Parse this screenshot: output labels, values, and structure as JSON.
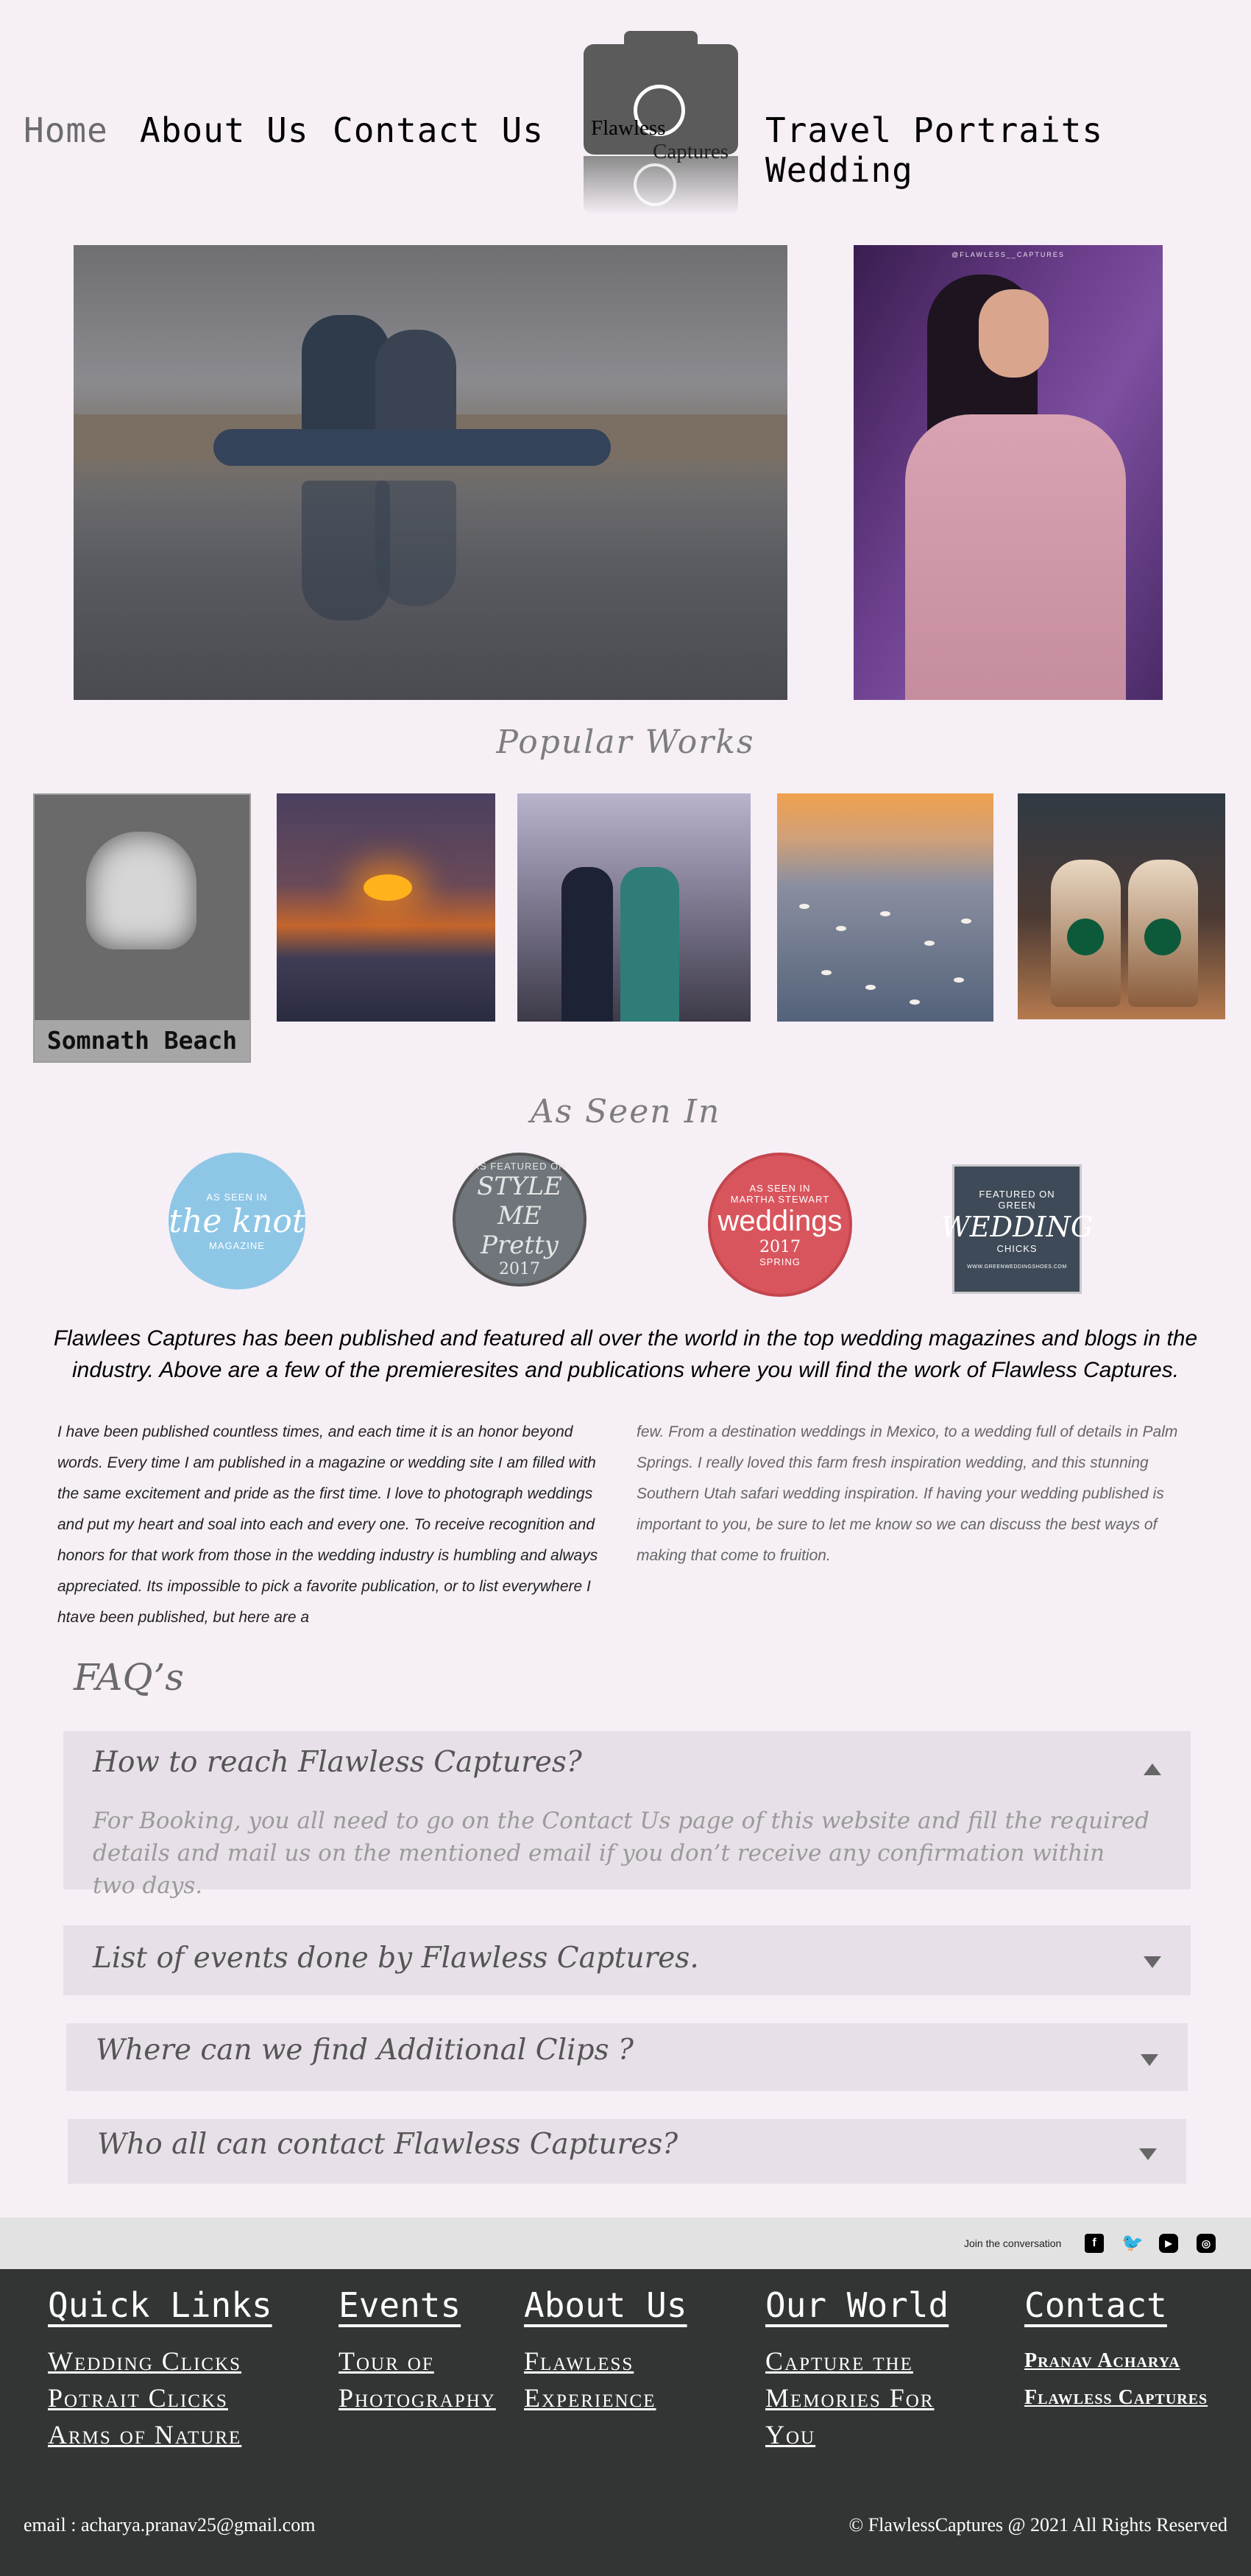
{
  "nav": {
    "home": "Home",
    "about": "About Us",
    "contact": "Contact Us",
    "right_links": "Travel Portraits Wedding",
    "logo_line1": "Flawless",
    "logo_line2": "Captures"
  },
  "hero": {
    "right_tag": "@FLAWLESS__CAPTURES"
  },
  "popular": {
    "title": "Popular Works",
    "items": [
      {
        "caption": "Somnath Beach",
        "icon": "cave-photo"
      },
      {
        "icon": "sunset-photo"
      },
      {
        "icon": "wedding-photo"
      },
      {
        "icon": "birds-photo"
      },
      {
        "icon": "coffee-photo"
      }
    ]
  },
  "seen": {
    "title": "As Seen In",
    "badges": [
      {
        "top": "AS SEEN IN",
        "main": "the knot",
        "bottom": "MAGAZINE",
        "color": "#8ec6e6"
      },
      {
        "top": "AS FEATURED ON",
        "main": "STYLE ME Pretty",
        "bottom": "2017",
        "color": "#6f757b"
      },
      {
        "top": "AS SEEN IN",
        "sub": "MARTHA STEWART",
        "main": "weddings",
        "bottom": "2017",
        "tail": "SPRING",
        "color": "#d9555d"
      },
      {
        "top": "FEATURED ON",
        "main": "WEDDING",
        "sub": "GREEN",
        "bottom": "CHICKS",
        "foot": "WWW.GREENWEDDINGSHOES.COM",
        "color": "#3e4a57"
      }
    ],
    "intro": "Flawlees Captures has been published and featured all over the world in the top wedding magazines and blogs in the industry. Above are a few of the premieresites and publications where you will find the work of Flawless Captures.",
    "col1": "I have been published countless times, and each time it is an honor beyond  words. Every time I am published in a magazine or wedding site I am filled with the same excitement and pride as the first time. I love to photograph weddings and put my heart and soal into each and every one. To receive recognition and honors for that work from those in the wedding industry is humbling and always appreciated. Its impossible to pick a favorite publication, or to list everywhere I htave been published, but here are a",
    "col2": "few. From a destination weddings in Mexico, to a wedding full of details in Palm Springs. I really loved this farm fresh inspiration wedding, and this stunning Southern Utah safari wedding inspiration.  If having your wedding published is important to you, be sure to let me know so we can discuss the best ways of making that come to fruition."
  },
  "faq": {
    "title": "FAQ’s",
    "items": [
      {
        "question": "How to reach Flawless Captures?",
        "answer": "For Booking, you all need to go on the Contact Us page of this website and fill the required details and mail us on the mentioned email if you don’t receive any confirmation within two days.",
        "expanded": true
      },
      {
        "question": "List of events done by Flawless Captures.",
        "expanded": false
      },
      {
        "question": "Where can we find Additional Clips ?",
        "expanded": false
      },
      {
        "question": "Who all can contact Flawless Captures?",
        "expanded": false
      }
    ]
  },
  "social": {
    "label": "Join the conversation",
    "icons": [
      "facebook-icon",
      "twitter-icon",
      "youtube-icon",
      "instagram-icon"
    ]
  },
  "footer": {
    "quick": {
      "title": "Quick Links",
      "links": [
        "Wedding Clicks",
        "Potrait Clicks",
        "Arms of Nature"
      ]
    },
    "events": {
      "title": "Events",
      "links": [
        "Tour of",
        "Photography"
      ]
    },
    "about": {
      "title": "About Us",
      "links": [
        "Flawless",
        "Experience"
      ]
    },
    "world": {
      "title": "Our World",
      "links": [
        "Capture the",
        "Memories For",
        "You"
      ]
    },
    "contact": {
      "title": "Contact",
      "links": [
        "Pranav Acharya",
        "Flawless Captures"
      ]
    },
    "email": "email : acharya.pranav25@gmail.com",
    "copyright": "© FlawlessCaptures @ 2021 All Rights Reserved"
  }
}
